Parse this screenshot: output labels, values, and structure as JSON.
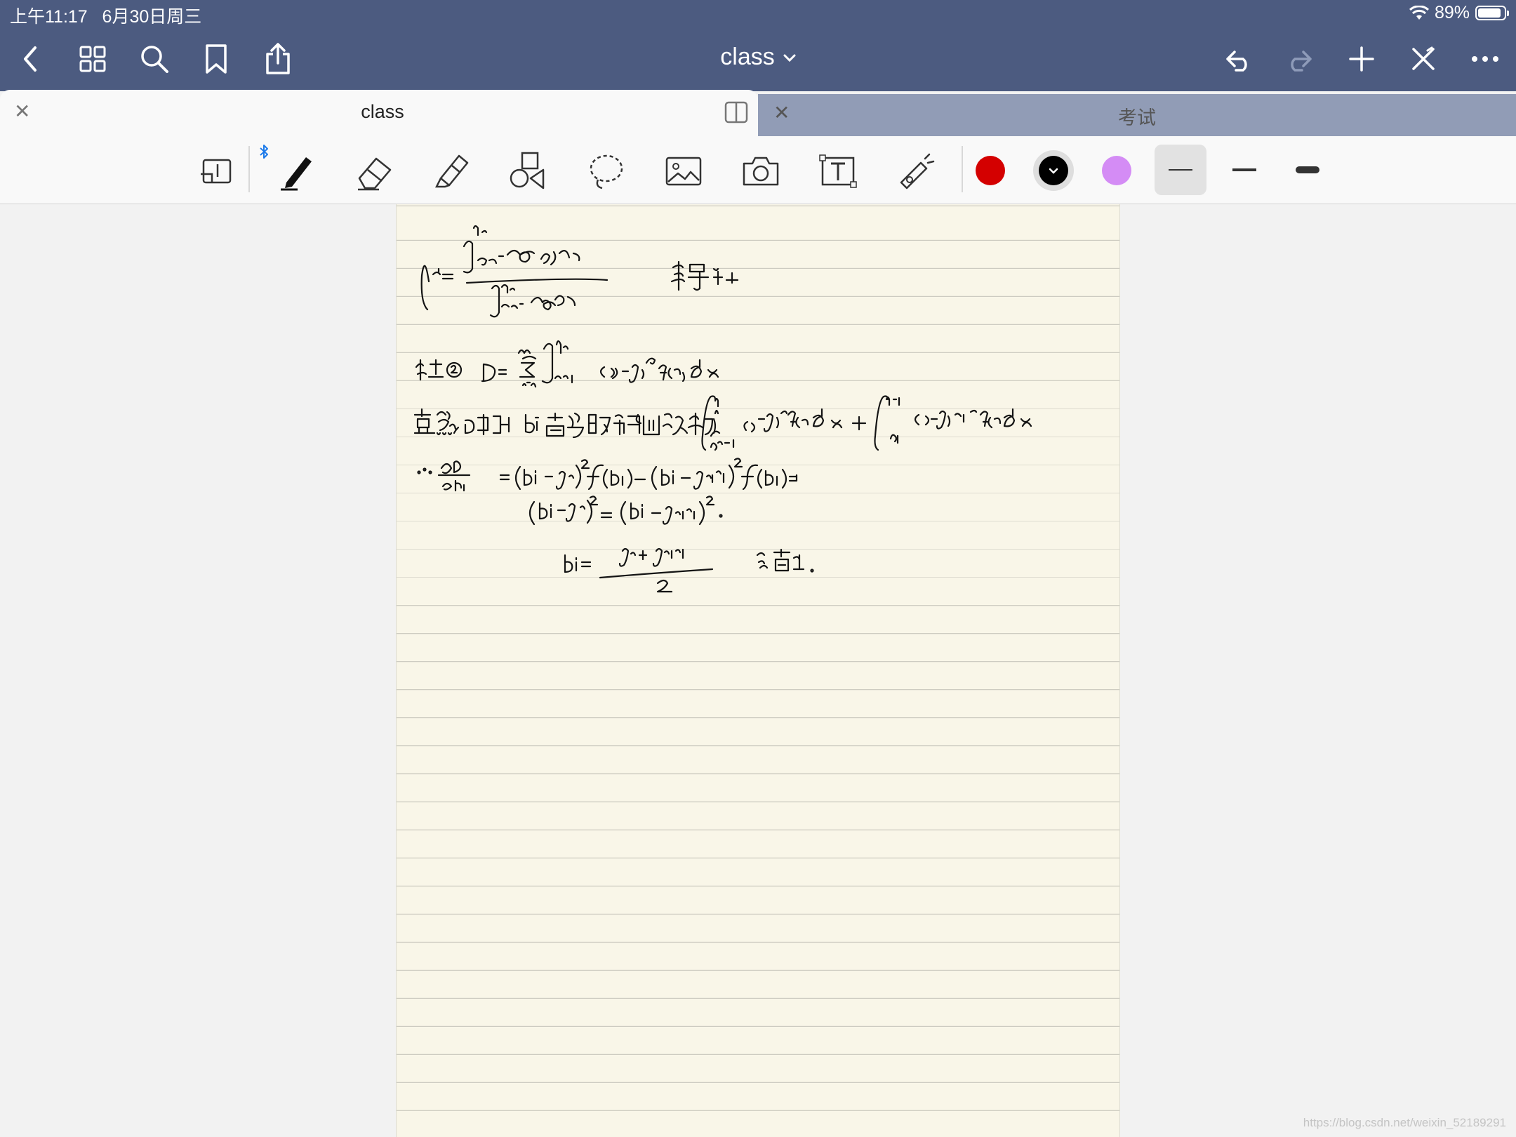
{
  "status_bar": {
    "time_date": "上午11:17   6月30日周三",
    "battery": "89%",
    "battery_level": 0.89
  },
  "nav": {
    "title": "class",
    "icons": [
      "back-icon",
      "thumbnails-icon",
      "search-icon",
      "bookmark-icon",
      "share-icon",
      "undo-icon",
      "redo-icon",
      "add-page-icon",
      "close-edit-icon",
      "more-icon"
    ]
  },
  "tabs": [
    {
      "label": "class",
      "active": true
    },
    {
      "label": "考试",
      "active": false
    }
  ],
  "toolbar": {
    "tools": [
      "zoom-window",
      "pen",
      "eraser",
      "highlighter",
      "shapes",
      "lasso",
      "image",
      "camera",
      "text",
      "laser-pointer"
    ],
    "colors": [
      "#d40000",
      "#000000",
      "#d48cf5"
    ],
    "selected_color": "#000000",
    "stroke_widths": [
      "thin",
      "medium",
      "thick"
    ],
    "selected_stroke": "thin"
  },
  "watermark": "https://blog.csdn.net/weixin_52189291"
}
